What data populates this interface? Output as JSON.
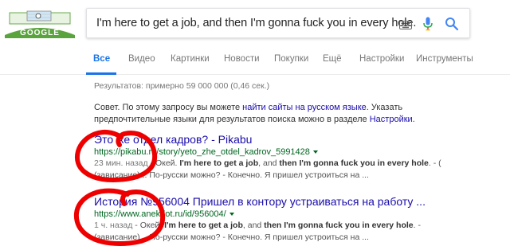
{
  "search": {
    "query": "I'm here to get a job, and then I'm gonna fuck you in every hole."
  },
  "logo": {
    "text": "GOOGLE"
  },
  "tabs": [
    {
      "label": "Все",
      "active": true
    },
    {
      "label": "Видео"
    },
    {
      "label": "Картинки"
    },
    {
      "label": "Новости"
    },
    {
      "label": "Покупки"
    },
    {
      "label": "Ещё"
    },
    {
      "label": "Настройки"
    },
    {
      "label": "Инструменты"
    }
  ],
  "stats": "Результатов: примерно 59 000 000 (0,46 сек.)",
  "advice": {
    "prefix": "Совет. По этому запросу вы можете ",
    "link1": "найти сайты на русском языке",
    "middle": ". Указать предпочтительные языки для результатов поиска можно в разделе ",
    "link2": "Настройки",
    "suffix": "."
  },
  "results": [
    {
      "title": "Это же отдел кадров? - Pikabu",
      "url": "https://pikabu.ru/story/yeto_zhe_otdel_kadrov_5991428",
      "time": "23 мин. назад",
      "snippet_a": " - Окей. ",
      "bold1": "I'm here to get a job",
      "snippet_b": ", and ",
      "bold2": "then I'm gonna fuck you in every hole",
      "snippet_c": ". - ( (зависание)... По-русски можно? - Конечно. Я пришел устроиться на ..."
    },
    {
      "title": "История №956004 Пришел в контору устраиваться на работу ...",
      "url": "https://www.anekdot.ru/id/956004/",
      "time": "1 ч. назад",
      "snippet_a": " - Окей. ",
      "bold1": "I'm here to get a job",
      "snippet_b": ", and ",
      "bold2": "then I'm gonna fuck you in every hole",
      "snippet_c": ". - (зависание)... По-русски можно? - Конечно. Я пришел устроиться на ..."
    }
  ],
  "colors": {
    "link": "#1a0dab",
    "url": "#006621",
    "accent": "#1a73e8",
    "scribble": "#ee0000"
  }
}
